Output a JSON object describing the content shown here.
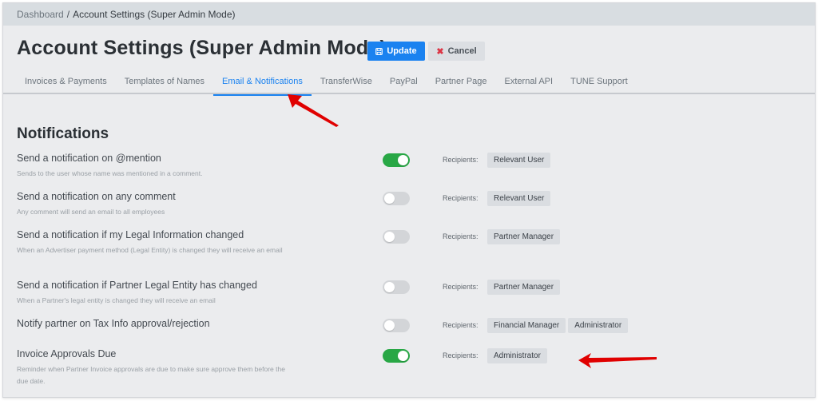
{
  "breadcrumb": {
    "items": [
      "Dashboard",
      "Account Settings (Super Admin Mode)"
    ],
    "separator": "/"
  },
  "header": {
    "title": "Account Settings (Super Admin Mode)",
    "update_label": "Update",
    "update_icon": "save-icon",
    "cancel_label": "Cancel",
    "cancel_icon": "close-icon"
  },
  "tabs": [
    {
      "label": "Invoices & Payments",
      "active": false
    },
    {
      "label": "Templates of Names",
      "active": false
    },
    {
      "label": "Email & Notifications",
      "active": true
    },
    {
      "label": "TransferWise",
      "active": false
    },
    {
      "label": "PayPal",
      "active": false
    },
    {
      "label": "Partner Page",
      "active": false
    },
    {
      "label": "External API",
      "active": false
    },
    {
      "label": "TUNE Support",
      "active": false
    }
  ],
  "notifications": {
    "title": "Notifications",
    "recipients_label": "Recipients:",
    "items": [
      {
        "label": "Send a notification on @mention",
        "description": "Sends to the user whose name was mentioned in a comment.",
        "enabled": true,
        "recipients": [
          "Relevant User"
        ]
      },
      {
        "label": "Send a notification on any comment",
        "description": "Any comment will send an email to all employees",
        "enabled": false,
        "recipients": [
          "Relevant User"
        ]
      },
      {
        "label": "Send a notification if my Legal Information changed",
        "description": "When an Advertiser payment method (Legal Entity) is changed they will receive an email",
        "enabled": false,
        "recipients": [
          "Partner Manager"
        ]
      },
      {
        "label": "Send a notification if Partner Legal Entity has changed",
        "description": "When a Partner's legal entity is changed they will receive an email",
        "enabled": false,
        "recipients": [
          "Partner Manager"
        ]
      },
      {
        "label": "Notify partner on Tax Info approval/rejection",
        "description": "",
        "enabled": false,
        "recipients": [
          "Financial Manager",
          "Administrator"
        ]
      },
      {
        "label": "Invoice Approvals Due",
        "description": "Reminder when Partner Invoice approvals are due to make sure approve them before the due date.",
        "enabled": true,
        "recipients": [
          "Administrator"
        ]
      }
    ]
  },
  "colors": {
    "accent": "#1a82f0",
    "toggle_on": "#28a745",
    "annotation_arrow": "#e00000"
  }
}
